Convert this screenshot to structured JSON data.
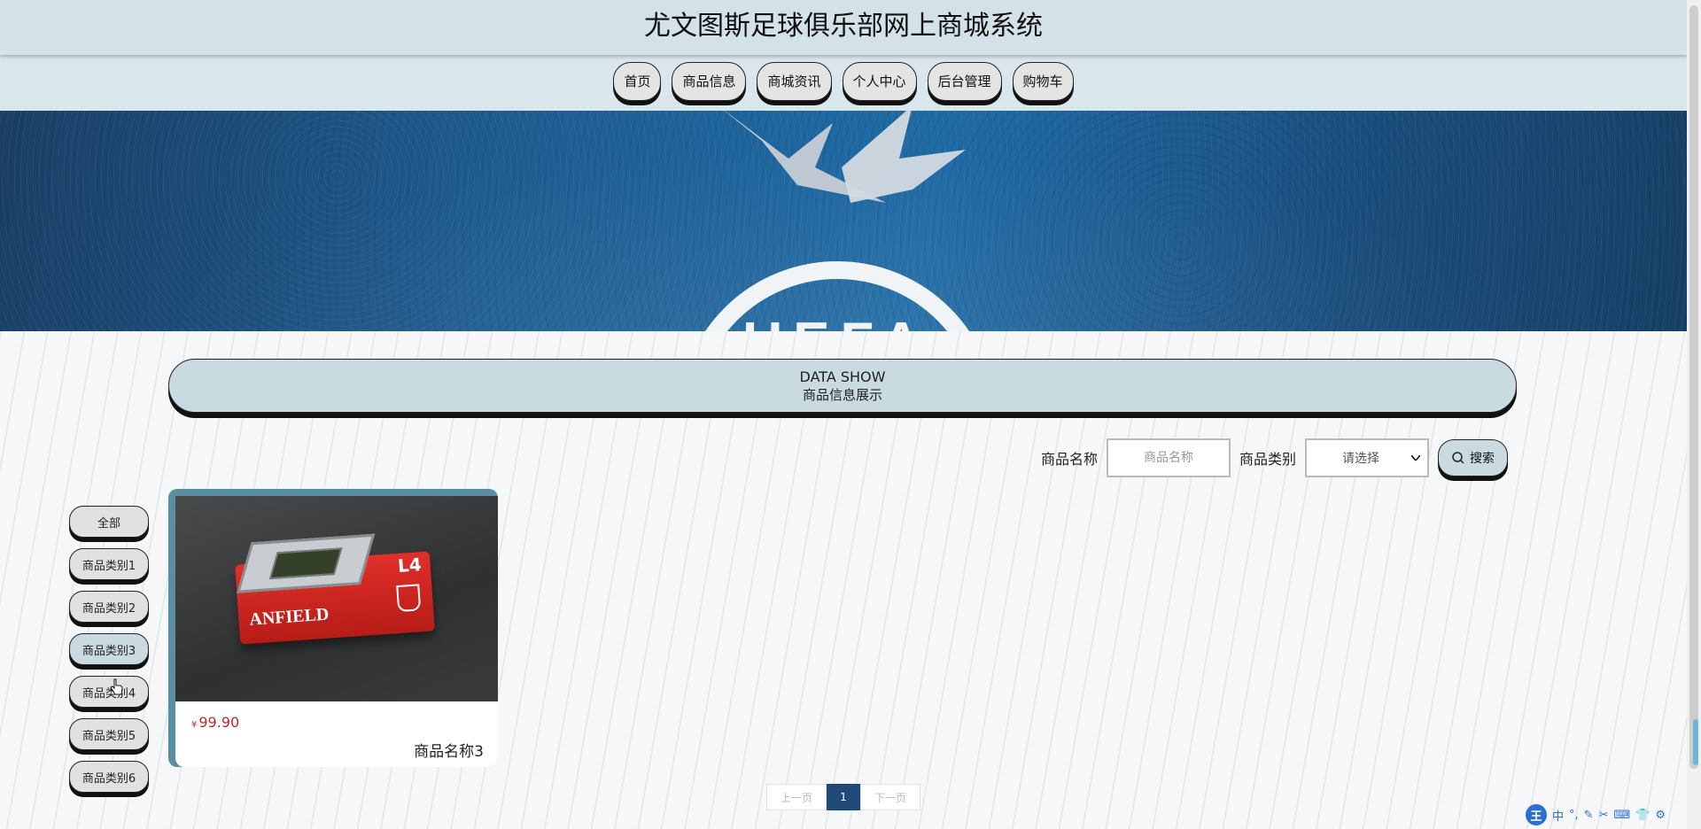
{
  "header": {
    "title": "尤文图斯足球俱乐部网上商城系统"
  },
  "nav": [
    {
      "label": "首页"
    },
    {
      "label": "商品信息"
    },
    {
      "label": "商城资讯"
    },
    {
      "label": "个人中心"
    },
    {
      "label": "后台管理"
    },
    {
      "label": "购物车"
    }
  ],
  "banner": {
    "logo_text": "UEFA"
  },
  "section": {
    "en_title": "DATA SHOW",
    "cn_title": "商品信息展示"
  },
  "search": {
    "name_label": "商品名称",
    "name_placeholder": "商品名称",
    "category_label": "商品类别",
    "category_selected": "请选择",
    "button_label": "搜索"
  },
  "categories": [
    {
      "label": "全部"
    },
    {
      "label": "商品类别1"
    },
    {
      "label": "商品类别2"
    },
    {
      "label": "商品类别3"
    },
    {
      "label": "商品类别4"
    },
    {
      "label": "商品类别5"
    },
    {
      "label": "商品类别6"
    }
  ],
  "products": [
    {
      "currency": "¥",
      "price": "99.90",
      "name": "商品名称3",
      "image_text_l4": "L4",
      "image_text_anfield": "ANFIELD"
    }
  ],
  "pagination": {
    "prev": "上一页",
    "current": "1",
    "next": "下一页"
  },
  "ime": {
    "logo": "王",
    "mode": "中"
  },
  "colors": {
    "accent": "#c9dae1",
    "price": "#c0262c",
    "page_active": "#1f4a78"
  }
}
